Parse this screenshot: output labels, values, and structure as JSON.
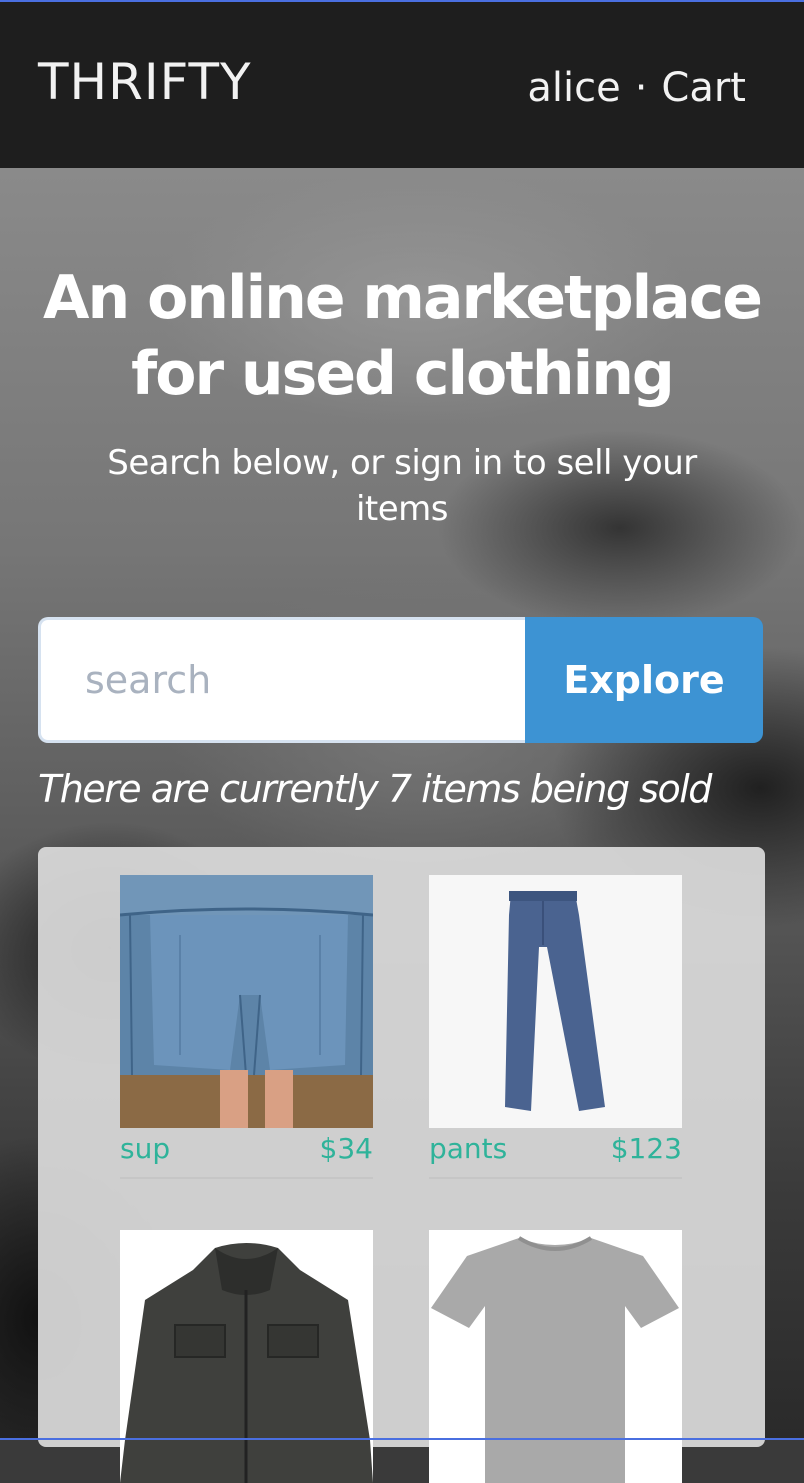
{
  "header": {
    "brand": "THRIFTY",
    "user": "alice",
    "separator": "·",
    "cart_label": "Cart"
  },
  "hero": {
    "title": "An online marketplace for used clothing",
    "subtitle": "Search below, or sign in to sell your items"
  },
  "search": {
    "placeholder": "search",
    "value": "",
    "button_label": "Explore"
  },
  "items_count_text": "There are currently 7 items being sold",
  "items": [
    {
      "name": "sup",
      "price": "$34",
      "image": "denim-shorts-photo"
    },
    {
      "name": "pants",
      "price": "$123",
      "image": "blue-pants-photo"
    },
    {
      "name": "",
      "price": "",
      "image": "dark-jacket-photo"
    },
    {
      "name": "",
      "price": "",
      "image": "gray-tshirt-photo"
    }
  ],
  "colors": {
    "header_bg": "#1e1e1e",
    "accent": "#3d93d3",
    "item_text": "#2fb39a",
    "border_accent": "#4a6fe0"
  }
}
